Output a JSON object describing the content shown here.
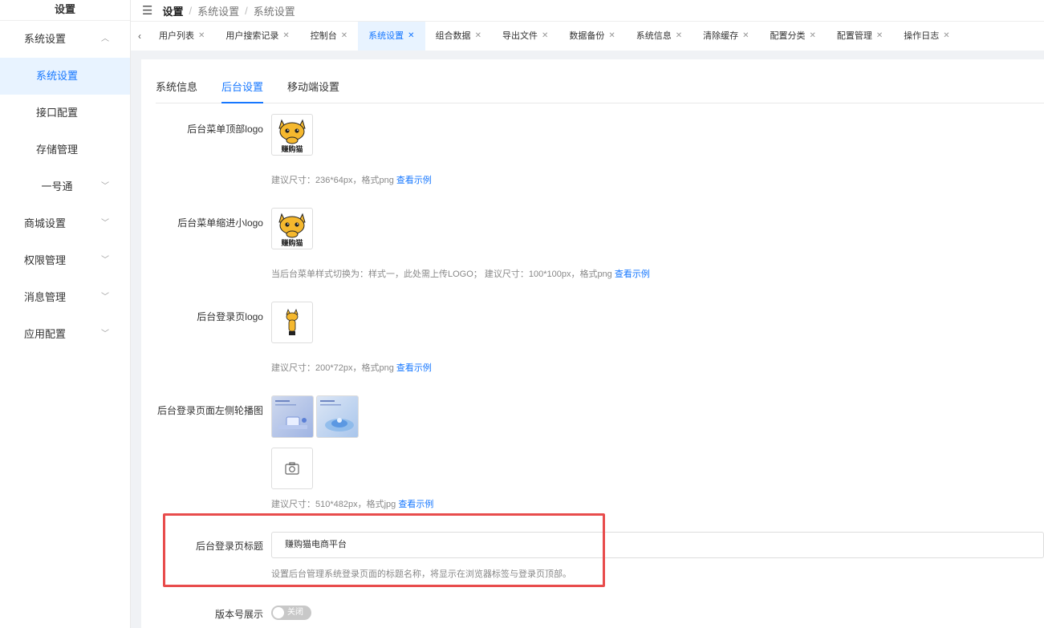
{
  "sidebar": {
    "title": "设置",
    "items": [
      {
        "label": "系统设置",
        "chevron": "chevron-up"
      },
      {
        "label": "系统设置"
      },
      {
        "label": "接口配置"
      },
      {
        "label": "存储管理"
      },
      {
        "label": "一号通",
        "chevron": "chevron-down"
      },
      {
        "label": "商城设置",
        "chevron": "chevron-down"
      },
      {
        "label": "权限管理",
        "chevron": "chevron-down"
      },
      {
        "label": "消息管理",
        "chevron": "chevron-down"
      },
      {
        "label": "应用配置",
        "chevron": "chevron-down"
      }
    ]
  },
  "header": {
    "breadcrumb": [
      "设置",
      "系统设置",
      "系统设置"
    ],
    "separator": "/"
  },
  "tabs": [
    "用户列表",
    "用户搜索记录",
    "控制台",
    "系统设置",
    "组合数据",
    "导出文件",
    "数据备份",
    "系统信息",
    "清除缓存",
    "配置分类",
    "配置管理",
    "操作日志"
  ],
  "active_tab": "系统设置",
  "subtabs": [
    "系统信息",
    "后台设置",
    "移动端设置"
  ],
  "active_subtab": "后台设置",
  "form": {
    "menu_top_logo": {
      "label": "后台菜单顶部logo",
      "hint": "建议尺寸：236*64px，格式png",
      "link": "查看示例",
      "logo_text": "赚购猫"
    },
    "menu_small_logo": {
      "label": "后台菜单缩进小logo",
      "hint": "当后台菜单样式切换为：样式一，此处需上传LOGO； 建议尺寸：100*100px，格式png",
      "link": "查看示例",
      "logo_text": "赚购猫"
    },
    "login_logo": {
      "label": "后台登录页logo",
      "hint": "建议尺寸：200*72px，格式png",
      "link": "查看示例"
    },
    "login_carousel": {
      "label": "后台登录页面左侧轮播图",
      "hint": "建议尺寸：510*482px，格式jpg",
      "link": "查看示例"
    },
    "login_title": {
      "label": "后台登录页标题",
      "value": "赚购猫电商平台",
      "hint": "设置后台管理系统登录页面的标题名称，将显示在浏览器标签与登录页顶部。"
    },
    "version_display": {
      "label": "版本号展示",
      "toggle_text": "关闭",
      "enabled": false
    }
  },
  "colors": {
    "accent": "#1677ff",
    "highlight": "#e84c4c",
    "cat_yellow": "#f5b82e"
  },
  "icons": {
    "menu": "hamburger-icon",
    "upload": "camera-icon",
    "tab_prev": "chevron-left-icon",
    "close": "close-icon"
  }
}
